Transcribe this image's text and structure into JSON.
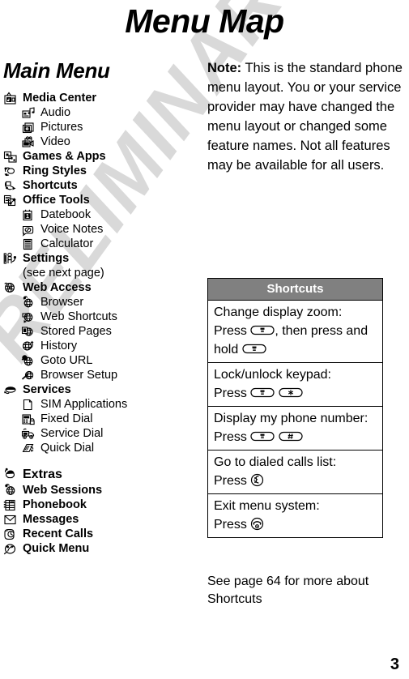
{
  "document": {
    "title": "Menu Map",
    "page_number": "3"
  },
  "watermark": {
    "text": "PRELIMINARY",
    "color": "#d9d9d9"
  },
  "main_menu": {
    "heading": "Main Menu",
    "items": [
      {
        "label": "Media Center",
        "level": 1,
        "icon": "tv-media-icon"
      },
      {
        "label": "Audio",
        "level": 2,
        "icon": "audio-note-icon"
      },
      {
        "label": "Pictures",
        "level": 2,
        "icon": "pictures-icon"
      },
      {
        "label": "Video",
        "level": 2,
        "icon": "video-camera-icon"
      },
      {
        "label": "Games & Apps",
        "level": 1,
        "icon": "games-apps-icon"
      },
      {
        "label": "Ring Styles",
        "level": 1,
        "icon": "ring-styles-icon"
      },
      {
        "label": "Shortcuts",
        "level": 1,
        "icon": "shortcuts-icon"
      },
      {
        "label": "Office Tools",
        "level": 1,
        "icon": "office-tools-icon"
      },
      {
        "label": "Datebook",
        "level": 2,
        "icon": "datebook-icon"
      },
      {
        "label": "Voice Notes",
        "level": 2,
        "icon": "voice-notes-icon"
      },
      {
        "label": "Calculator",
        "level": 2,
        "icon": "calculator-icon"
      },
      {
        "label": "Settings",
        "level": 1,
        "icon": "settings-icon"
      },
      {
        "label": "(see next page)",
        "level": 0,
        "icon": "none"
      },
      {
        "label": "Web Access",
        "level": 1,
        "icon": "web-access-icon"
      },
      {
        "label": "Browser",
        "level": 2,
        "icon": "browser-icon"
      },
      {
        "label": "Web Shortcuts",
        "level": 2,
        "icon": "web-shortcuts-icon"
      },
      {
        "label": "Stored Pages",
        "level": 2,
        "icon": "stored-pages-icon"
      },
      {
        "label": "History",
        "level": 2,
        "icon": "history-icon"
      },
      {
        "label": "Goto URL",
        "level": 2,
        "icon": "goto-url-icon"
      },
      {
        "label": "Browser Setup",
        "level": 2,
        "icon": "browser-setup-icon"
      },
      {
        "label": "Services",
        "level": 1,
        "icon": "services-icon"
      },
      {
        "label": "SIM Applications",
        "level": 2,
        "icon": "sim-applications-icon"
      },
      {
        "label": "Fixed Dial",
        "level": 2,
        "icon": "fixed-dial-icon"
      },
      {
        "label": "Service Dial",
        "level": 2,
        "icon": "service-dial-icon"
      },
      {
        "label": "Quick Dial",
        "level": 2,
        "icon": "quick-dial-icon"
      }
    ]
  },
  "extras_menu": {
    "items": [
      {
        "label": "Extras",
        "level": 1,
        "icon": "extras-icon",
        "big": true
      },
      {
        "label": "Web Sessions",
        "level": 1,
        "icon": "web-sessions-icon",
        "big": false
      },
      {
        "label": "Phonebook",
        "level": 1,
        "icon": "phonebook-icon",
        "big": false
      },
      {
        "label": "Messages",
        "level": 1,
        "icon": "messages-icon",
        "big": false
      },
      {
        "label": "Recent Calls",
        "level": 1,
        "icon": "recent-calls-icon",
        "big": false
      },
      {
        "label": "Quick Menu",
        "level": 1,
        "icon": "quick-menu-icon",
        "big": false
      }
    ]
  },
  "note": {
    "bold_prefix": "Note:",
    "body": " This is the standard phone menu layout. You or your service provider may have changed the menu layout or changed some feature names. Not all features may be available for all users."
  },
  "shortcuts_table": {
    "header": "Shortcuts",
    "header_bg": "#808080",
    "header_color": "#ffffff",
    "rows": [
      {
        "parts": [
          {
            "kind": "text",
            "value": "Change display zoom:"
          },
          {
            "kind": "break"
          },
          {
            "kind": "text",
            "value": "Press "
          },
          {
            "kind": "key",
            "value": "menu-key"
          },
          {
            "kind": "text",
            "value": ", then press and hold "
          },
          {
            "kind": "key",
            "value": "menu-key"
          }
        ]
      },
      {
        "parts": [
          {
            "kind": "text",
            "value": "Lock/unlock keypad:"
          },
          {
            "kind": "break"
          },
          {
            "kind": "text",
            "value": "Press "
          },
          {
            "kind": "key",
            "value": "menu-key"
          },
          {
            "kind": "text",
            "value": " "
          },
          {
            "kind": "key",
            "value": "star-key"
          }
        ]
      },
      {
        "parts": [
          {
            "kind": "text",
            "value": "Display my phone number:"
          },
          {
            "kind": "break"
          },
          {
            "kind": "text",
            "value": "Press "
          },
          {
            "kind": "key",
            "value": "menu-key"
          },
          {
            "kind": "text",
            "value": " "
          },
          {
            "kind": "key",
            "value": "pound-key"
          }
        ]
      },
      {
        "parts": [
          {
            "kind": "text",
            "value": "Go to dialed calls list:"
          },
          {
            "kind": "break"
          },
          {
            "kind": "text",
            "value": "Press "
          },
          {
            "kind": "key",
            "value": "send-key"
          }
        ]
      },
      {
        "parts": [
          {
            "kind": "text",
            "value": "Exit menu system:"
          },
          {
            "kind": "break"
          },
          {
            "kind": "text",
            "value": "Press "
          },
          {
            "kind": "key",
            "value": "end-key"
          }
        ]
      }
    ]
  },
  "see_page": {
    "text": "See page 64 for more about Shortcuts"
  }
}
